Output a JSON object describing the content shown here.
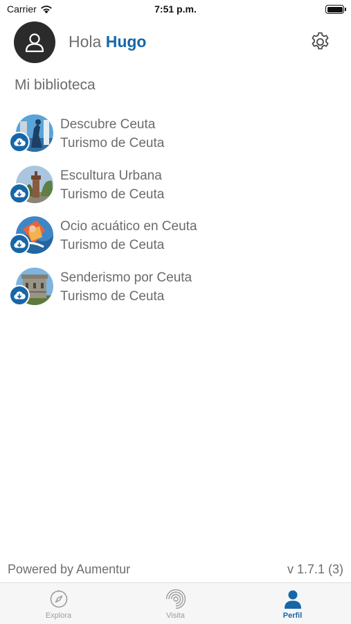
{
  "status_bar": {
    "carrier": "Carrier",
    "time": "7:51 p.m."
  },
  "header": {
    "greeting": "Hola",
    "user_name": "Hugo"
  },
  "library": {
    "title": "Mi biblioteca",
    "items": [
      {
        "title": "Descubre Ceuta",
        "subtitle": "Turismo de Ceuta"
      },
      {
        "title": "Escultura Urbana",
        "subtitle": "Turismo de Ceuta"
      },
      {
        "title": "Ocio acuático en Ceuta",
        "subtitle": "Turismo de Ceuta"
      },
      {
        "title": "Senderismo por Ceuta",
        "subtitle": "Turismo de Ceuta"
      }
    ]
  },
  "footer": {
    "powered_by": "Powered by Aumentur",
    "version": "v 1.7.1 (3)"
  },
  "tabs": [
    {
      "label": "Explora",
      "icon": "compass-icon",
      "active": false
    },
    {
      "label": "Visita",
      "icon": "visit-signal-icon",
      "active": false
    },
    {
      "label": "Perfil",
      "icon": "person-icon",
      "active": true
    }
  ],
  "colors": {
    "accent": "#1766a8",
    "text": "#6b6b6b",
    "tab_bar": "#f6f6f6",
    "avatar": "#2b2b2b"
  }
}
